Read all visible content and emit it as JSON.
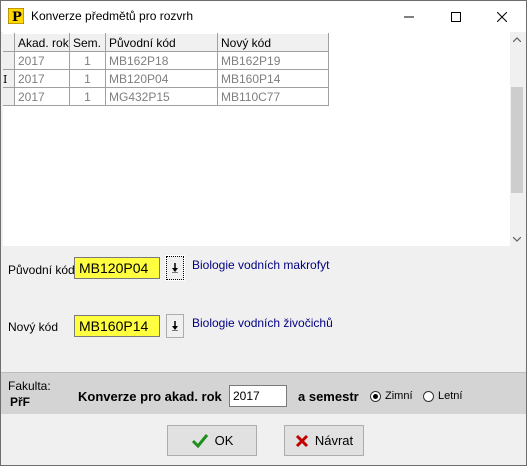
{
  "window": {
    "title": "Konverze předmětů pro rozvrh"
  },
  "grid": {
    "columns": [
      "Akad. rok",
      "Sem.",
      "Původní kód",
      "Nový kód"
    ],
    "rows": [
      [
        "2017",
        "1",
        "MB162P18",
        "MB162P19"
      ],
      [
        "2017",
        "1",
        "MB120P04",
        "MB160P14"
      ],
      [
        "2017",
        "1",
        "MG432P15",
        "MB110C77"
      ]
    ],
    "current_row": 2
  },
  "form": {
    "original_code_label": "Původní kód",
    "original_code_value": "MB120P04",
    "original_desc": "Biologie vodních makrofyt",
    "new_code_label": "Nový kód",
    "new_code_value": "MB160P14",
    "new_desc": "Biologie vodních živočichů"
  },
  "bottom": {
    "faculty_label": "Fakulta:",
    "faculty_value": "PřF",
    "conversion_label": "Konverze pro akad. rok",
    "year_value": "2017",
    "semester_label": "a semestr",
    "winter_label": "Zimní",
    "summer_label": "Letní",
    "selected_semester": "Zimní"
  },
  "buttons": {
    "ok_label": "OK",
    "back_label": "Návrat"
  },
  "colors": {
    "highlight": "#ffff40",
    "desc_text": "#000080",
    "ok_check": "#1e8e1e",
    "back_x": "#c00000"
  }
}
